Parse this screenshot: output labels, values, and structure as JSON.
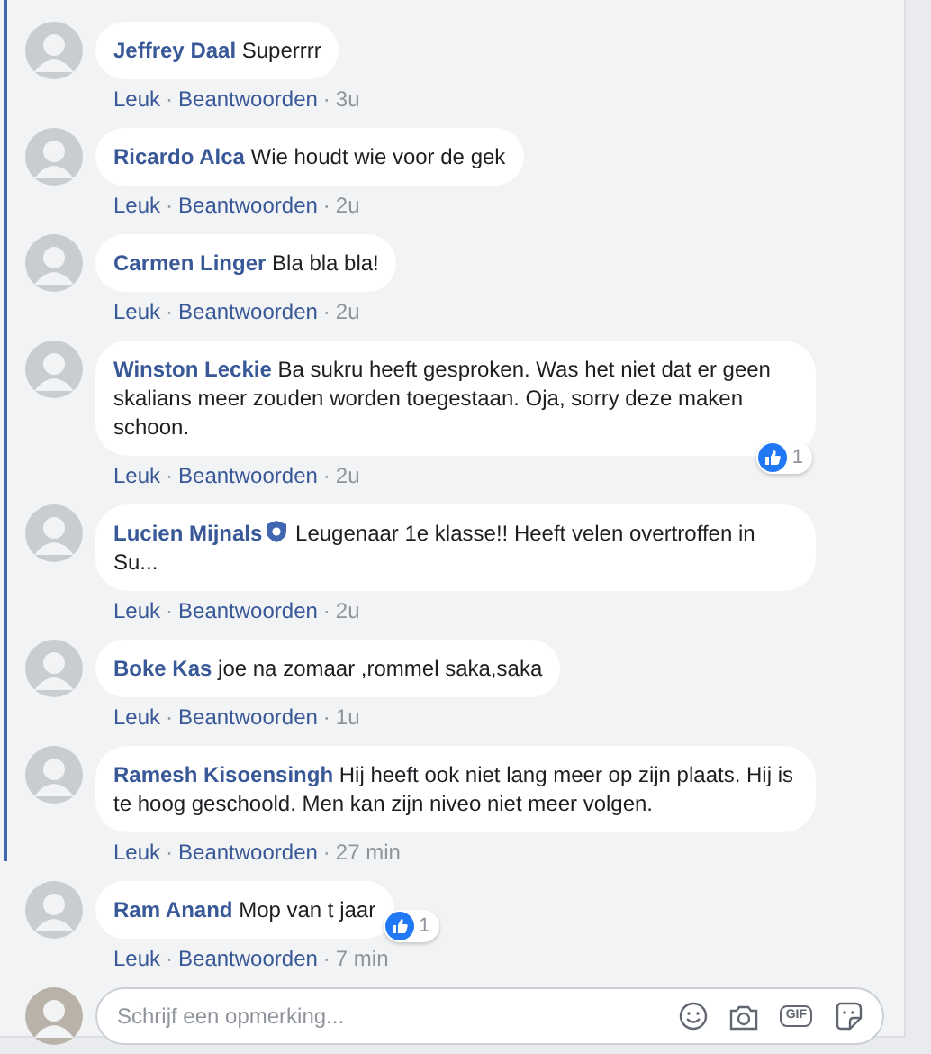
{
  "comments": [
    {
      "author": "Jeffrey Daal",
      "verified": false,
      "text": "Superrrr",
      "actions": [
        "Leuk",
        "·",
        "Beantwoorden",
        "·"
      ],
      "time": "3u"
    },
    {
      "author": "Ricardo Alca",
      "verified": false,
      "text": "Wie houdt wie voor de gek",
      "actions": [
        "Leuk",
        "·",
        "Beantwoorden",
        "·"
      ],
      "time": "2u"
    },
    {
      "author": "Carmen Linger",
      "verified": false,
      "text": "Bla bla bla!",
      "actions": [
        "Leuk",
        "·",
        "Beantwoorden",
        "·"
      ],
      "time": "2u"
    },
    {
      "author": "Winston Leckie",
      "verified": false,
      "text": "Ba sukru heeft gesproken. Was het niet dat er geen skalians meer zouden worden toegestaan. Oja, sorry deze maken schoon.",
      "actions": [
        "Leuk",
        "·",
        "Beantwoorden",
        "·"
      ],
      "time": "2u",
      "likes": "1"
    },
    {
      "author": "Lucien Mijnals",
      "verified": true,
      "text": "Leugenaar 1e klasse!! Heeft velen overtroffen in Su...",
      "actions": [
        "Leuk",
        "·",
        "Beantwoorden",
        "·"
      ],
      "time": "2u"
    },
    {
      "author": "Boke Kas",
      "verified": false,
      "text": "joe na zomaar ,rommel saka,saka",
      "actions": [
        "Leuk",
        "·",
        "Beantwoorden",
        "·"
      ],
      "time": "1u"
    },
    {
      "author": "Ramesh Kisoensingh",
      "verified": false,
      "text": "Hij heeft ook niet lang meer op zijn plaats. Hij is te hoog geschoold. Men kan zijn niveo niet meer volgen.",
      "actions": [
        "Leuk",
        "·",
        "Beantwoorden",
        "·"
      ],
      "time": "27 min"
    },
    {
      "author": "Ram Anand",
      "verified": false,
      "text": "Mop van t jaar",
      "actions": [
        "Leuk",
        "·",
        "Beantwoorden",
        "·"
      ],
      "time": "7 min",
      "likes": "1"
    }
  ],
  "composer": {
    "placeholder": "Schrijf een opmerking...",
    "gif_label": "GIF"
  }
}
